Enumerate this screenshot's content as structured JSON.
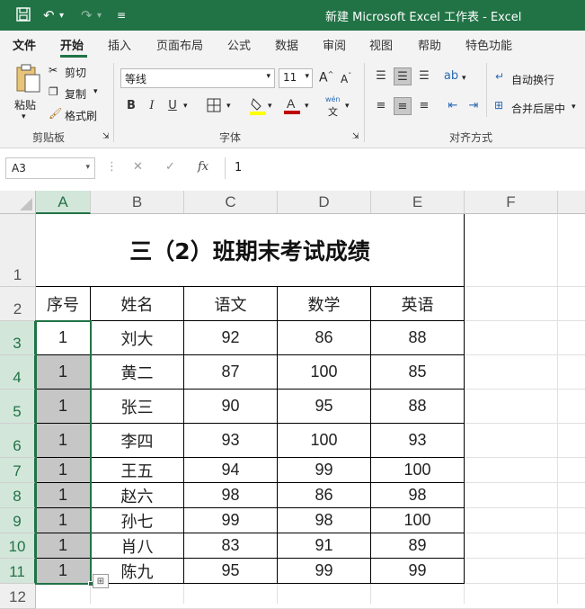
{
  "titlebar": {
    "title": "新建 Microsoft Excel 工作表  -  Excel",
    "save_icon": "save-icon",
    "undo_icon": "undo-icon",
    "redo_icon": "redo-icon",
    "customize_icon": "customize-qat-icon",
    "color": "#217346"
  },
  "menu": {
    "items": [
      "文件",
      "开始",
      "插入",
      "页面布局",
      "公式",
      "数据",
      "审阅",
      "视图",
      "帮助",
      "特色功能"
    ],
    "active": "开始"
  },
  "ribbon": {
    "clipboard": {
      "paste": "粘贴",
      "cut": "剪切",
      "copy": "复制",
      "format_painter": "格式刷",
      "label": "剪贴板"
    },
    "font": {
      "name": "等线",
      "size": "11",
      "label": "字体",
      "bold": "B",
      "italic": "I",
      "underline": "U",
      "grow": "A",
      "shrink": "A",
      "phonetic": "wén",
      "font_color": "#c00000",
      "fill_color": "#ffff00"
    },
    "alignment": {
      "wrap_text": "自动换行",
      "merge_center": "合并后居中",
      "label": "对齐方式"
    }
  },
  "formula_bar": {
    "name_box": "A3",
    "formula": "1",
    "fx": "fx"
  },
  "sheet": {
    "columns": [
      "A",
      "B",
      "C",
      "D",
      "E",
      "F"
    ],
    "rows": [
      "1",
      "2",
      "3",
      "4",
      "5",
      "6",
      "7",
      "8",
      "9",
      "10",
      "11",
      "12"
    ],
    "title": "三（2）班期末考试成绩",
    "headers": [
      "序号",
      "姓名",
      "语文",
      "数学",
      "英语"
    ],
    "records": [
      [
        "1",
        "刘大",
        "92",
        "86",
        "88"
      ],
      [
        "1",
        "黄二",
        "87",
        "100",
        "85"
      ],
      [
        "1",
        "张三",
        "90",
        "95",
        "88"
      ],
      [
        "1",
        "李四",
        "93",
        "100",
        "93"
      ],
      [
        "1",
        "王五",
        "94",
        "99",
        "100"
      ],
      [
        "1",
        "赵六",
        "98",
        "86",
        "98"
      ],
      [
        "1",
        "孙七",
        "99",
        "98",
        "100"
      ],
      [
        "1",
        "肖八",
        "83",
        "91",
        "89"
      ],
      [
        "1",
        "陈九",
        "95",
        "99",
        "99"
      ]
    ],
    "selection_color": "#217346"
  }
}
